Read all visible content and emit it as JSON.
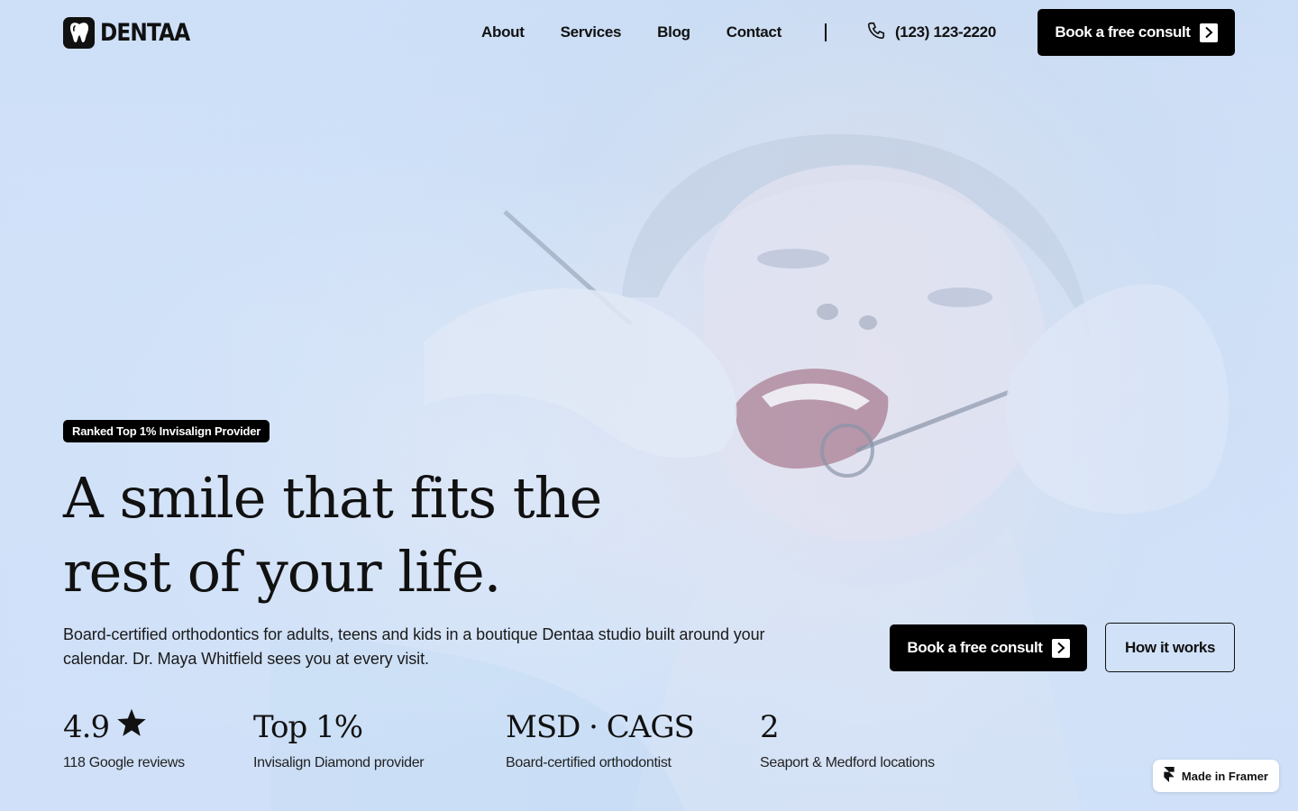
{
  "brand": {
    "name": "DENTAA",
    "logo_icon": "tooth-icon"
  },
  "nav": {
    "links": [
      "About",
      "Services",
      "Blog",
      "Contact"
    ],
    "phone": "(123) 123-2220",
    "phone_icon": "phone-icon"
  },
  "header_cta": {
    "label": "Book a free consult",
    "icon": "chevron-right-icon"
  },
  "hero": {
    "badge": "Ranked Top 1% Invisalign Provider",
    "headline_line1": "A smile that fits the",
    "headline_line2": "rest of your life.",
    "subtext": "Board-certified orthodontics for adults, teens and kids in a boutique Dentaa studio built around your calendar. Dr. Maya Whitfield sees you at every visit.",
    "primary_cta": "Book a free consult",
    "secondary_cta": "How it works"
  },
  "stats": [
    {
      "value": "4.9",
      "icon": "star-icon",
      "label": "118 Google reviews"
    },
    {
      "value": "Top 1%",
      "label": "Invisalign Diamond provider"
    },
    {
      "value": "MSD · CAGS",
      "label": "Board-certified orthodontist"
    },
    {
      "value": "2",
      "label": "Seaport & Medford locations"
    }
  ],
  "framer_badge": {
    "label": "Made in Framer",
    "icon": "framer-icon"
  },
  "colors": {
    "background": "#cfe0f6",
    "primary": "#000000",
    "text": "#111111"
  }
}
